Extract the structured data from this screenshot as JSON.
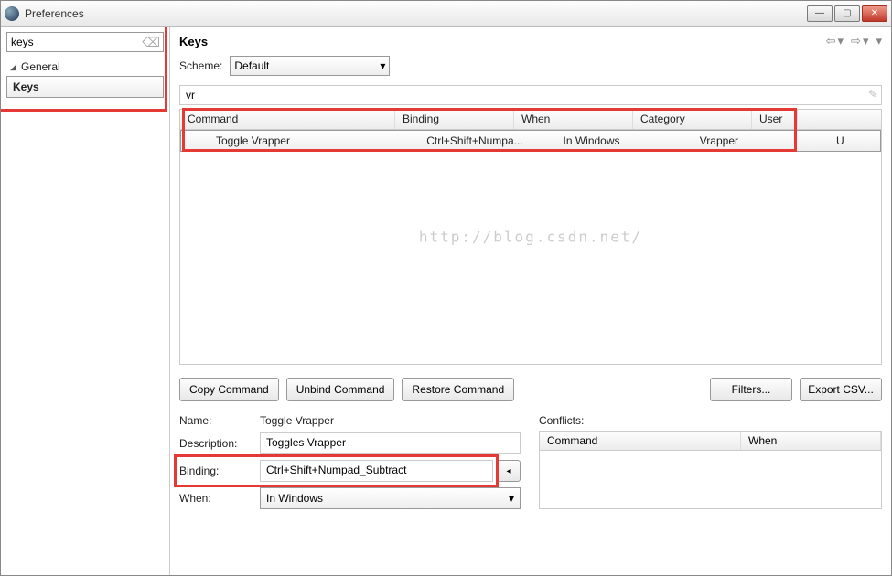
{
  "window": {
    "title": "Preferences"
  },
  "sidebar": {
    "search_value": "keys",
    "items": [
      {
        "label": "General",
        "expanded": true
      },
      {
        "label": "Keys",
        "selected": true
      }
    ]
  },
  "page": {
    "title": "Keys",
    "scheme_label": "Scheme:",
    "scheme_value": "Default",
    "filter_value": "vr"
  },
  "table": {
    "headers": {
      "command": "Command",
      "binding": "Binding",
      "when": "When",
      "category": "Category",
      "user": "User"
    },
    "rows": [
      {
        "command": "Toggle Vrapper",
        "binding": "Ctrl+Shift+Numpa...",
        "when": "In Windows",
        "category": "Vrapper",
        "user": "U"
      }
    ]
  },
  "buttons": {
    "copy": "Copy Command",
    "unbind": "Unbind Command",
    "restore": "Restore Command",
    "filters": "Filters...",
    "export": "Export CSV..."
  },
  "details": {
    "name_label": "Name:",
    "name_value": "Toggle Vrapper",
    "desc_label": "Description:",
    "desc_value": "Toggles Vrapper",
    "binding_label": "Binding:",
    "binding_value": "Ctrl+Shift+Numpad_Subtract",
    "when_label": "When:",
    "when_value": "In Windows"
  },
  "conflicts": {
    "label": "Conflicts:",
    "headers": {
      "command": "Command",
      "when": "When"
    }
  },
  "watermark": "http://blog.csdn.net/"
}
